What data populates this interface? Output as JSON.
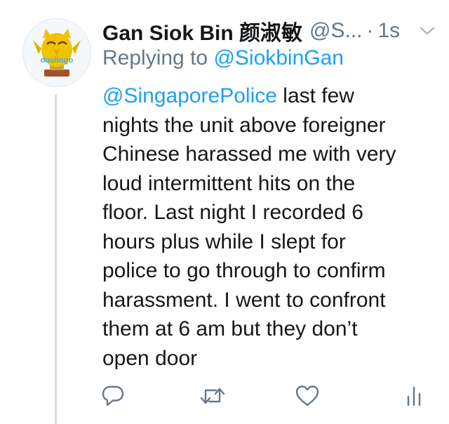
{
  "avatar": {
    "brand_text": "duolingo",
    "icon": "duolingo-owl-trophy"
  },
  "header": {
    "name": "Gan Siok Bin 颜淑敏",
    "handle": "@S...",
    "separator": "·",
    "time": "1s",
    "menu_icon": "chevron-down-icon"
  },
  "reply": {
    "prefix": "Replying to",
    "to": "@SiokbinGan"
  },
  "tweet": {
    "mention": "@SingaporePolice",
    "lines": [
      " last few",
      "nights the unit above foreigner",
      "Chinese harassed me with very",
      "loud intermittent hits on the",
      "floor. Last night I recorded 6",
      "hours plus while I slept for",
      "police to go through to confirm",
      "harassment. I went to confront",
      "them at 6 am but they don’t",
      "open door"
    ]
  },
  "actions": {
    "reply_icon": "reply-icon",
    "retweet_icon": "retweet-icon",
    "like_icon": "heart-icon",
    "analytics_icon": "analytics-icon"
  },
  "colors": {
    "link": "#1da1f2",
    "secondary_text": "#657786",
    "primary_text": "#14171a",
    "icon": "#657786",
    "thread_line": "#d5dde3"
  }
}
